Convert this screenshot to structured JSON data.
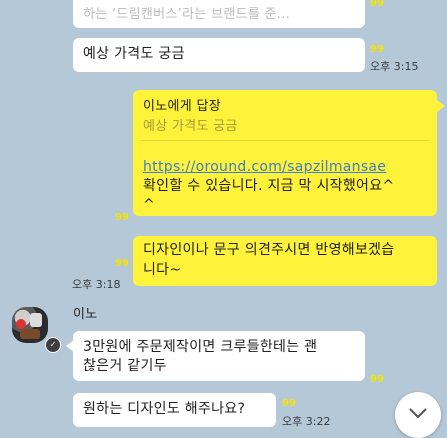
{
  "chat": {
    "top_partial": {
      "line1": "하는 ‘드림캔버스’라는 브랜드를 준...",
      "unread": "99"
    },
    "msg_price": {
      "text": "예상 가격도 궁금",
      "unread": "99",
      "time": "오후 3:15"
    },
    "reply": {
      "title": "이노에게 답장",
      "quoted": "예상 가격도 궁금",
      "link": "https://oround.com/sapzilmansae",
      "body_line1": "확인할 수 있습니다. 지금 막 시작했어요^",
      "body_line2": "^",
      "unread": "99"
    },
    "msg_design": {
      "line1": "디자인이나 문구 의견주시면 반영해보겠습",
      "line2": "니다~",
      "unread": "99",
      "time": "오후 3:18"
    },
    "sender": {
      "name": "이노"
    },
    "msg_order": {
      "line1": "3만원에 주문제작이면 크루들한테는 괜",
      "line2": "찮은거 같기두",
      "unread": "99"
    },
    "msg_want": {
      "text": "원하는 디자인도 해주나요?",
      "unread": "99",
      "time": "오후 3:22"
    },
    "colors": {
      "background": "#b5c8d8",
      "my_bubble": "#fff23a",
      "their_bubble": "#ffffff",
      "link": "#3a7fd0",
      "unread": "#f4e400"
    },
    "icons": {
      "scroll_down": "chevron-down-icon"
    }
  }
}
